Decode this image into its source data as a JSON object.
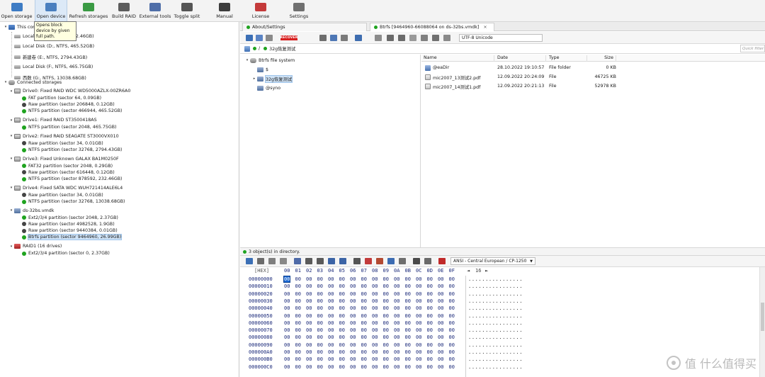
{
  "toolbar": {
    "items": [
      {
        "label": "Open storage",
        "icon": "open-storage-icon",
        "color": "#3e7cc4"
      },
      {
        "label": "Open device",
        "icon": "open-device-icon",
        "color": "#4a7fbf"
      },
      {
        "label": "Refresh storages",
        "icon": "refresh-icon",
        "color": "#3a9a43"
      },
      {
        "label": "Build RAID",
        "icon": "raid-icon",
        "color": "#5c5c5c"
      },
      {
        "label": "External tools",
        "icon": "tools-icon",
        "color": "#4f6ea8"
      },
      {
        "label": "Toggle split",
        "icon": "split-icon",
        "color": "#555555"
      },
      {
        "label": "Manual",
        "icon": "manual-icon",
        "color": "#3c3c3c"
      },
      {
        "label": "License",
        "icon": "license-icon",
        "color": "#c43a3a"
      },
      {
        "label": "Settings",
        "icon": "settings-icon",
        "color": "#6f6f6f"
      }
    ],
    "tooltip": "Opens block device by given full path."
  },
  "left_tree": {
    "this_computer": "This computer",
    "local_disks": [
      "Local Disk (C:, NTFS, 232.46GB)",
      "Local Disk (D:, NTFS, 465.52GB)",
      "新建卷 (E:, NTFS, 2794.43GB)",
      "Local Disk (F:, NTFS, 465.75GB)",
      "西数 (G:, NTFS, 13038.68GB)"
    ],
    "connected": "Connected storages",
    "drives": [
      {
        "name": "Drive0: Fixed RAID WDC WD5000AZLX-00ZR6A0",
        "parts": [
          [
            "FAT partition (sector 64, 0.09GB)",
            "green"
          ],
          [
            "Raw partition (sector 206848, 0.12GB)",
            "dark"
          ],
          [
            "NTFS partition (sector 466944, 465.52GB)",
            "green"
          ]
        ]
      },
      {
        "name": "Drive1: Fixed RAID ST3500418AS",
        "parts": [
          [
            "NTFS partition (sector 2048, 465.75GB)",
            "green"
          ]
        ]
      },
      {
        "name": "Drive2: Fixed RAID SEAGATE  ST3000VX010",
        "parts": [
          [
            "Raw partition (sector 34, 0.01GB)",
            "dark"
          ],
          [
            "NTFS partition (sector 32768, 2794.43GB)",
            "green"
          ]
        ]
      },
      {
        "name": "Drive3: Fixed Unknown GALAX BA1M0250F",
        "parts": [
          [
            "FAT32 partition (sector 2048, 0.29GB)",
            "green"
          ],
          [
            "Raw partition (sector 616448, 0.12GB)",
            "dark"
          ],
          [
            "NTFS partition (sector 878592, 232.46GB)",
            "green"
          ]
        ]
      },
      {
        "name": "Drive4: Fixed SATA WDC  WUH721414ALE6L4",
        "parts": [
          [
            "Raw partition (sector 34, 0.01GB)",
            "dark"
          ],
          [
            "NTFS partition (sector 32768, 13038.68GB)",
            "green"
          ]
        ]
      },
      {
        "name": "ds-32bs.vmdk",
        "parts": [
          [
            "Ext2/3/4 partition (sector 2048, 2.37GB)",
            "green"
          ],
          [
            "Raw partition (sector 4982528, 1.9GB)",
            "dark"
          ],
          [
            "Raw partition (sector 9440384, 0.01GB)",
            "dark"
          ],
          [
            "Btrfs partition (sector 9464960, 26.99GB)",
            "green"
          ]
        ]
      },
      {
        "name": "RAID1 (16 drives)",
        "parts": [
          [
            "Ext2/3/4 partition (sector 0, 2.37GB)",
            "green"
          ]
        ]
      }
    ],
    "selected_part": "Btrfs partition (sector 9464960, 26.99GB)"
  },
  "tabs": [
    {
      "label": "About/Settings",
      "status_color": "#1fa31f"
    },
    {
      "label": "Btrfs [9464960-66088064 on ds-32bs.vmdk]",
      "status_color": "#1fa31f",
      "close": "×"
    }
  ],
  "pane_toolbar": {
    "recover_label": "RECOVER",
    "encoding": "UTF-8 Unicode"
  },
  "path": {
    "separator": "/",
    "current": "32g恢复测试",
    "quick_filter": "Quick filter"
  },
  "fs_tree": {
    "root": "Btrfs file system",
    "children": [
      "$",
      "32g恢复测试",
      "@syno"
    ],
    "selected": "32g恢复测试"
  },
  "file_list": {
    "columns": [
      "Name",
      "Date",
      "Type",
      "Size"
    ],
    "rows": [
      {
        "name": "@eaDir",
        "date": "28.10.2022 19:10:57",
        "type": "File folder",
        "size": "0 KB",
        "kind": "folder"
      },
      {
        "name": "mic2007_13测试2.pdf",
        "date": "12.09.2022 20:24:09",
        "type": "File",
        "size": "46725 KB",
        "kind": "file"
      },
      {
        "name": "mic2007_14测试1.pdf",
        "date": "12.09.2022 20:21:13",
        "type": "File",
        "size": "52978 KB",
        "kind": "file"
      }
    ]
  },
  "status": {
    "text": "3 object(s) in directory."
  },
  "hex": {
    "encoding": "ANSI - Central European / CP-1250",
    "header_label": "[HEX]",
    "columns": [
      "00",
      "01",
      "02",
      "03",
      "04",
      "05",
      "06",
      "07",
      "08",
      "09",
      "0A",
      "0B",
      "0C",
      "0D",
      "0E",
      "0F"
    ],
    "page_prev": "◄",
    "page_size": "16",
    "page_next": "►",
    "addresses": [
      "00000000",
      "00000010",
      "00000020",
      "00000030",
      "00000040",
      "00000050",
      "00000060",
      "00000070",
      "00000080",
      "00000090",
      "000000A0",
      "000000B0",
      "000000C0"
    ],
    "byte_value": "00",
    "ascii_row": "................"
  },
  "watermark": {
    "text": "值 什么值得买"
  }
}
